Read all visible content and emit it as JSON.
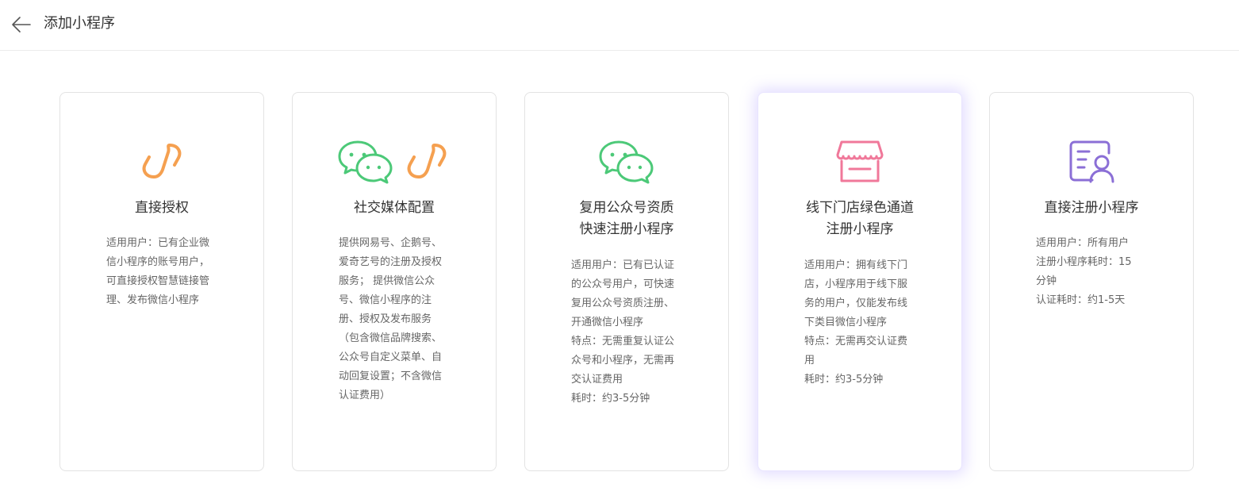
{
  "header": {
    "title": "添加小程序"
  },
  "colors": {
    "orange": "#f5a050",
    "green": "#4cc978",
    "pink": "#f0789a",
    "purple": "#8b6fd6"
  },
  "cards": [
    {
      "icons": [
        "link-icon"
      ],
      "title": [
        "直接授权"
      ],
      "desc": [
        "适用用户：已有企业微",
        "信小程序的账号用户，",
        "可直接授权智慧链接管",
        "理、发布微信小程序"
      ]
    },
    {
      "icons": [
        "wechat-icon",
        "link-icon"
      ],
      "title": [
        "社交媒体配置"
      ],
      "desc": [
        "提供网易号、企鹅号、",
        "爱奇艺号的注册及授权",
        "服务； 提供微信公众",
        "号、微信小程序的注",
        "册、授权及发布服务",
        "（包含微信品牌搜索、",
        "公众号自定义菜单、自",
        "动回复设置；不含微信",
        "认证费用）"
      ]
    },
    {
      "icons": [
        "wechat-icon"
      ],
      "title": [
        "复用公众号资质",
        "快速注册小程序"
      ],
      "desc": [
        "适用用户：已有已认证",
        "的公众号用户，可快速",
        "复用公众号资质注册、",
        "开通微信小程序",
        "特点：无需重复认证公",
        "众号和小程序，无需再",
        "交认证费用",
        "耗时：约3-5分钟"
      ]
    },
    {
      "icons": [
        "store-icon"
      ],
      "title": [
        "线下门店绿色通道",
        "注册小程序"
      ],
      "desc": [
        "适用用户：拥有线下门",
        "店，小程序用于线下服",
        "务的用户，仅能发布线",
        "下类目微信小程序",
        "特点：无需再交认证费",
        "用",
        "耗时：约3-5分钟"
      ]
    },
    {
      "icons": [
        "register-user-icon"
      ],
      "title": [
        "直接注册小程序"
      ],
      "desc": [
        "适用用户：所有用户",
        "注册小程序耗时：15",
        "分钟",
        "认证耗时：约1-5天"
      ]
    }
  ]
}
